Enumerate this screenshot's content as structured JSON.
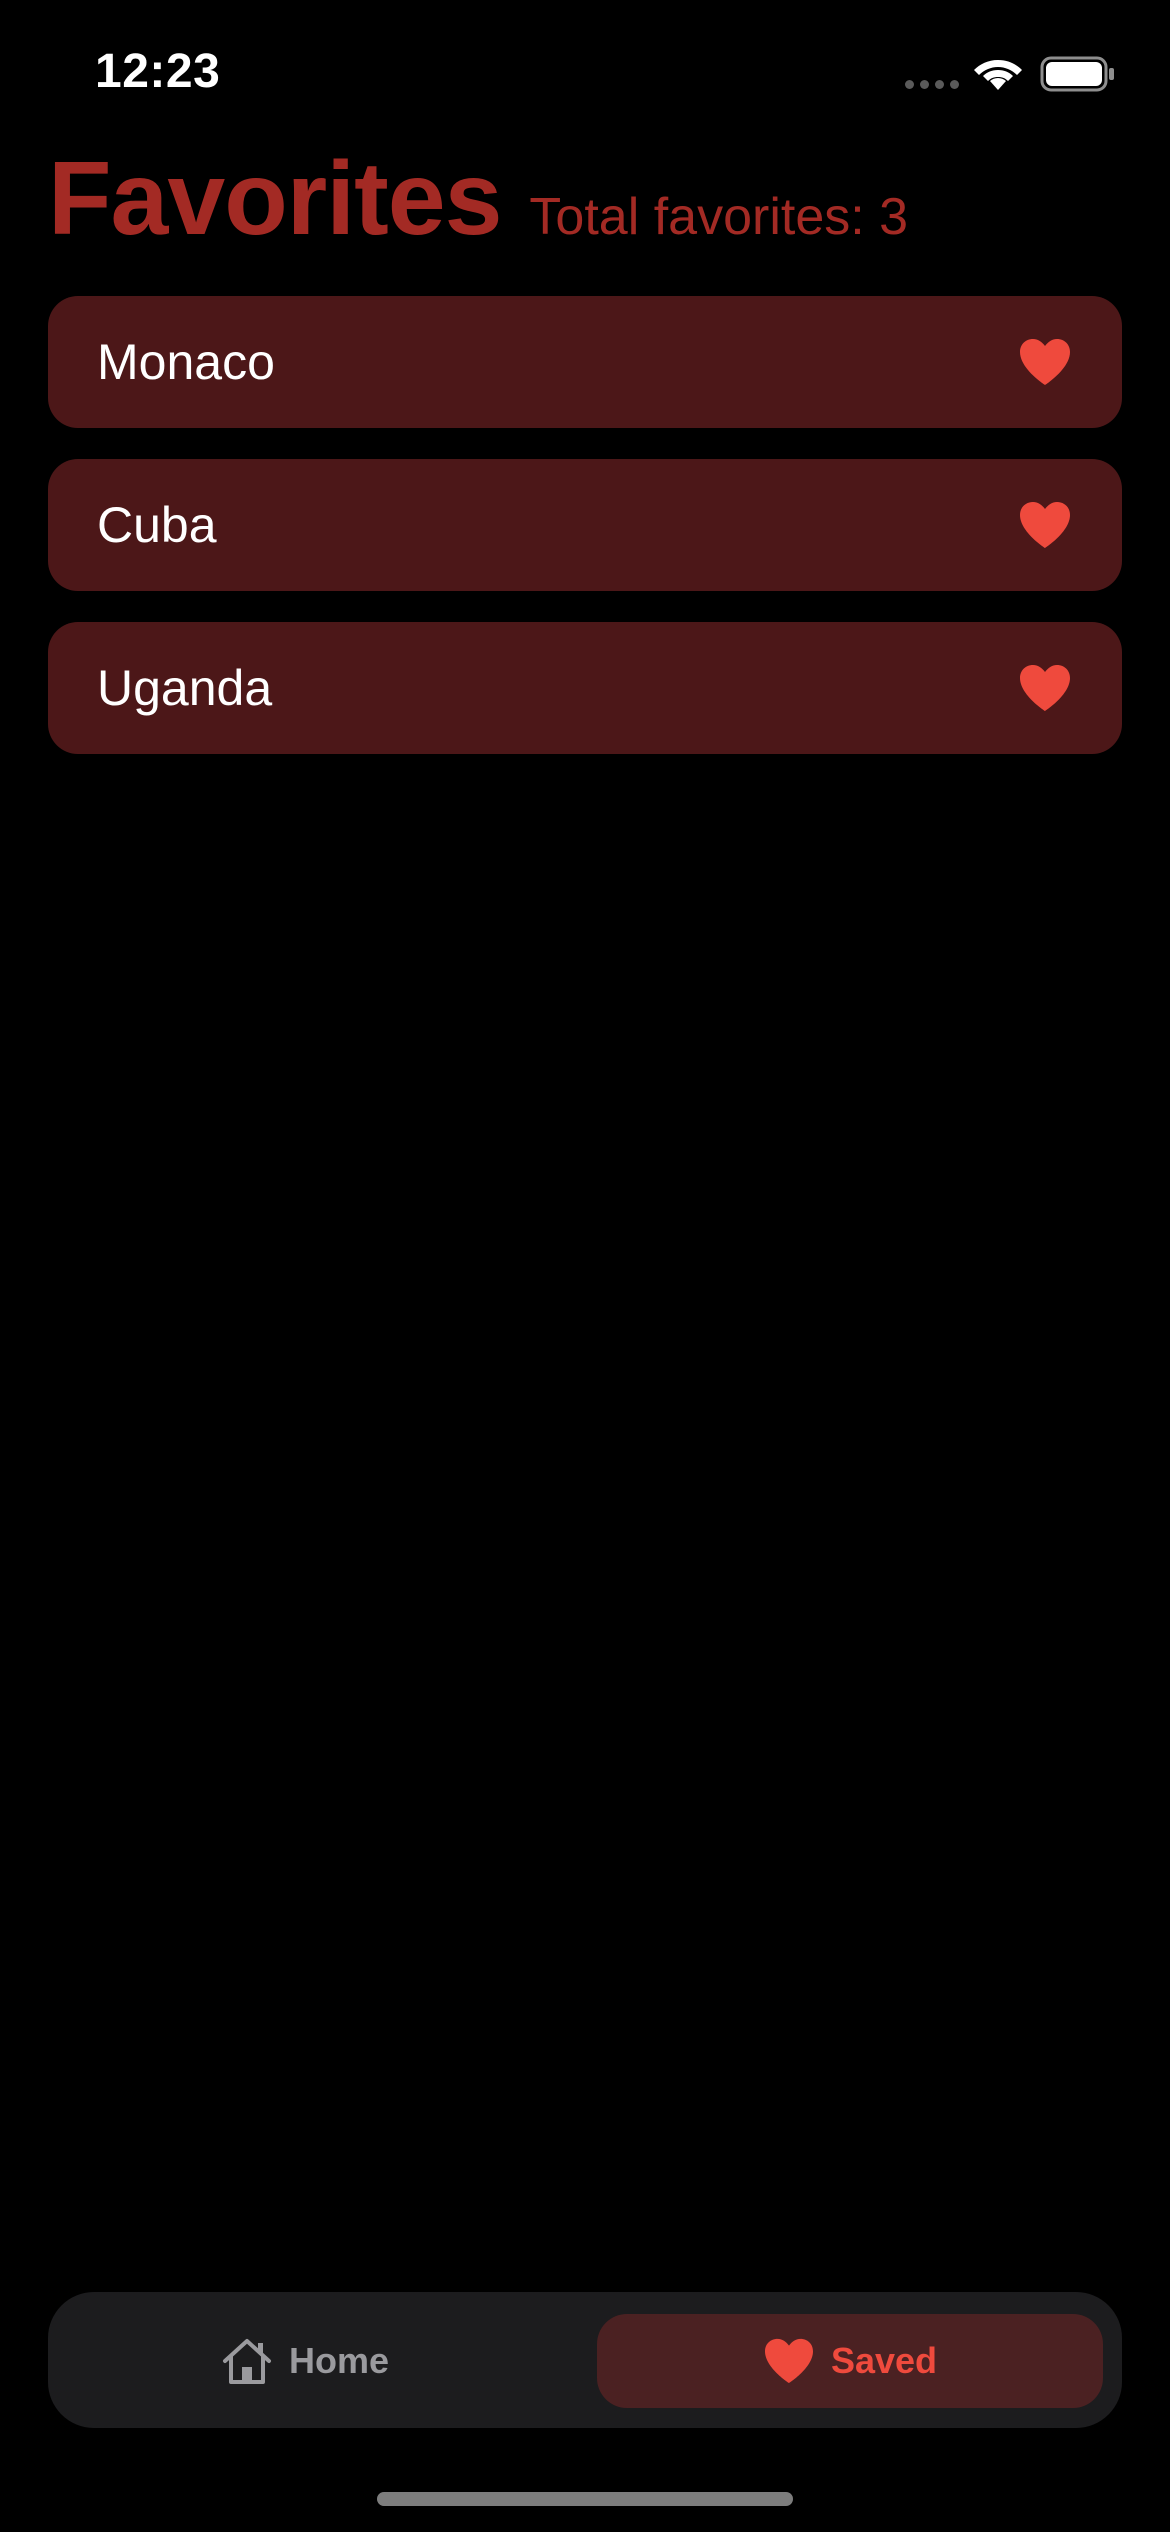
{
  "status_bar": {
    "time": "12:23"
  },
  "header": {
    "title": "Favorites",
    "total_text": "Total favorites: 3"
  },
  "favorites": [
    {
      "name": "Monaco",
      "icon": "heart-icon"
    },
    {
      "name": "Cuba",
      "icon": "heart-icon"
    },
    {
      "name": "Uganda",
      "icon": "heart-icon"
    }
  ],
  "tab_bar": {
    "tabs": [
      {
        "label": "Home",
        "icon": "house-icon",
        "selected": false
      },
      {
        "label": "Saved",
        "icon": "heart-icon",
        "selected": true
      }
    ]
  },
  "colors": {
    "background": "#000000",
    "accent_title": "#a32a24",
    "card": "#4c1718",
    "heart": "#ef4a3d",
    "tab_bar": "#1c1c1e",
    "tab_selected": "#4b2122",
    "tab_unselected_text": "#9a9a9e"
  }
}
